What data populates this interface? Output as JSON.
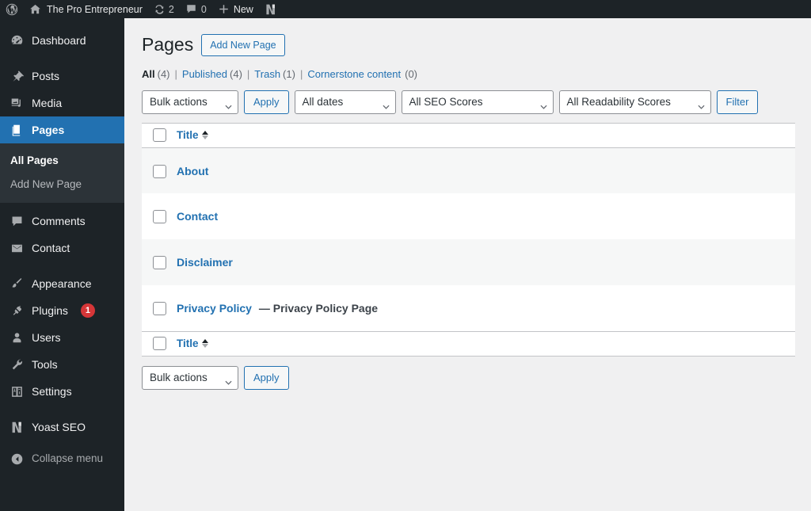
{
  "adminbar": {
    "wp_logo_icon": "wordpress-logo-icon",
    "home_icon": "home-icon",
    "site_name": "The Pro Entrepreneur",
    "updates_icon": "updates-icon",
    "updates_count": "2",
    "comments_icon": "comment-bubble-icon",
    "comments_count": "0",
    "new_icon": "plus-icon",
    "new_label": "New",
    "yoast_icon": "yoast-logo-icon"
  },
  "sidebar": {
    "items": [
      {
        "label": "Dashboard",
        "icon": "dashboard-icon",
        "name": "dashboard"
      },
      {
        "label": "Posts",
        "icon": "pin-icon",
        "name": "posts"
      },
      {
        "label": "Media",
        "icon": "media-icon",
        "name": "media"
      },
      {
        "label": "Pages",
        "icon": "pages-icon",
        "name": "pages"
      },
      {
        "label": "Comments",
        "icon": "comment-bubble-icon",
        "name": "comments"
      },
      {
        "label": "Contact",
        "icon": "envelope-icon",
        "name": "contact"
      },
      {
        "label": "Appearance",
        "icon": "paintbrush-icon",
        "name": "appearance"
      },
      {
        "label": "Plugins",
        "icon": "plug-icon",
        "name": "plugins",
        "badge": "1"
      },
      {
        "label": "Users",
        "icon": "user-icon",
        "name": "users"
      },
      {
        "label": "Tools",
        "icon": "wrench-icon",
        "name": "tools"
      },
      {
        "label": "Settings",
        "icon": "settings-sliders-icon",
        "name": "settings"
      },
      {
        "label": "Yoast SEO",
        "icon": "yoast-logo-icon",
        "name": "yoast-seo"
      }
    ],
    "submenu": [
      {
        "label": "All Pages",
        "name": "all-pages"
      },
      {
        "label": "Add New Page",
        "name": "add-new-page"
      }
    ],
    "collapse": {
      "label": "Collapse menu",
      "icon": "collapse-arrow-icon"
    },
    "accent_current": "#2271b1",
    "badge_color": "#d63638"
  },
  "header": {
    "title": "Pages",
    "add_new_label": "Add New Page"
  },
  "views": [
    {
      "label": "All",
      "count": "(4)",
      "current": true
    },
    {
      "label": "Published",
      "count": "(4)",
      "current": false
    },
    {
      "label": "Trash",
      "count": "(1)",
      "current": false
    },
    {
      "label": "Cornerstone content",
      "count": "(0)",
      "current": false
    }
  ],
  "views_separator": "|",
  "toolbar_top": {
    "bulk_actions": "Bulk actions",
    "apply_label": "Apply",
    "all_dates": "All dates",
    "all_seo_scores": "All SEO Scores",
    "all_readability_scores": "All Readability Scores",
    "filter_label": "Filter"
  },
  "toolbar_bottom": {
    "bulk_actions": "Bulk actions",
    "apply_label": "Apply"
  },
  "table": {
    "column_title": "Title",
    "sort_icon": "sort-arrows-icon",
    "rows": [
      {
        "title": "About",
        "state": ""
      },
      {
        "title": "Contact",
        "state": ""
      },
      {
        "title": "Disclaimer",
        "state": ""
      },
      {
        "title": "Privacy Policy",
        "state": "— Privacy Policy Page"
      }
    ]
  }
}
